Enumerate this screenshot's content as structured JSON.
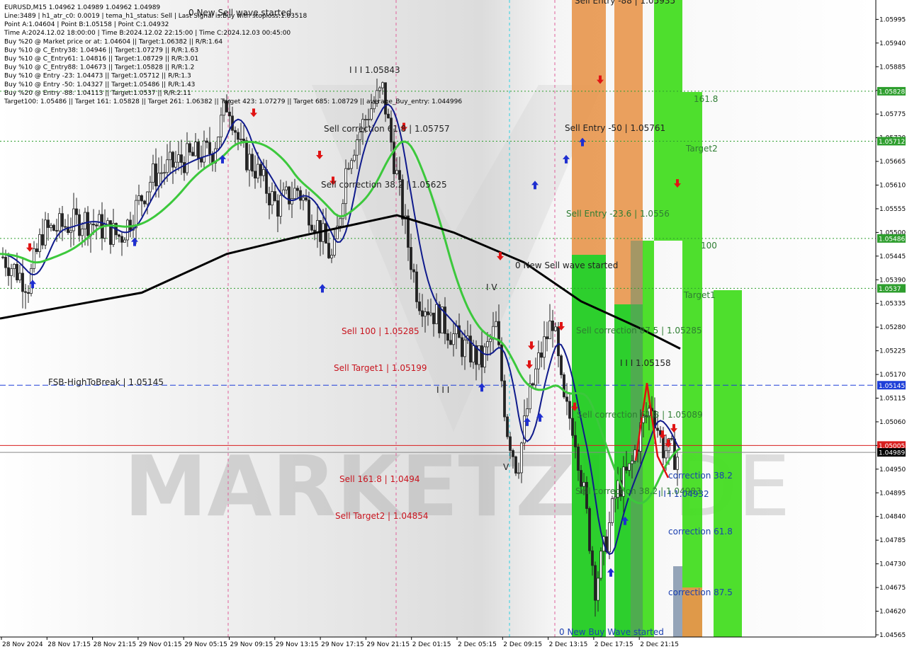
{
  "header": {
    "symbol_line": "EURUSD,M15   1.04962 1.04989 1.04962 1.04989",
    "info_lines": [
      "Line:3489 | h1_atr_c0: 0.0019 | tema_h1_status: Sell | Last Signal is:Buy with stoploss:1.03518",
      "Point A:1.04604 | Point B:1.05158 | Point C:1.04932",
      "Time A:2024.12.02 18:00:00 | Time B:2024.12.02 22:15:00 | Time C:2024.12.03 00:45:00",
      "Buy %20 @ Market price or at: 1.04604 || Target:1.06382 || R/R:1.64",
      "Buy %10 @ C_Entry38: 1.04946 || Target:1.07279 || R/R:1.63",
      "Buy %10 @ C_Entry61: 1.04816 || Target:1.08729 || R/R:3.01",
      "Buy %10 @ C_Entry88: 1.04673 || Target:1.05828 || R/R:1.2",
      "Buy %10 @ Entry -23: 1.04473 || Target:1.05712 || R/R:1.3",
      "Buy %10 @ Entry -50: 1.04327 || Target:1.05486 || R/R:1.43",
      "Buy %20 @ Entry -88: 1.04113 || Target:1.0537 || R/R:2.11",
      "Target100: 1.05486 || Target 161: 1.05828 || Target 261: 1.06382 || Target 423: 1.07279 || Target 685: 1.08729 || average_Buy_entry: 1.044996"
    ]
  },
  "watermark": "MARKETZI",
  "watermark_tail": "DE",
  "chart_data": {
    "type": "candlestick",
    "symbol": "EURUSD",
    "timeframe": "M15",
    "ylim": [
      1.0456,
      1.0604
    ],
    "price_ticks": [
      "1.05995",
      "1.05940",
      "1.05885",
      "1.05830",
      "1.05775",
      "1.05720",
      "1.05665",
      "1.05610",
      "1.05555",
      "1.05500",
      "1.05445",
      "1.05390",
      "1.05335",
      "1.05280",
      "1.05225",
      "1.05170",
      "1.05115",
      "1.05060",
      "1.05005",
      "1.04950",
      "1.04895",
      "1.04840",
      "1.04785",
      "1.04730",
      "1.04675",
      "1.04620",
      "1.04565"
    ],
    "time_ticks": [
      "28 Nov 2024",
      "28 Nov 17:15",
      "28 Nov 21:15",
      "29 Nov 01:15",
      "29 Nov 05:15",
      "29 Nov 09:15",
      "29 Nov 13:15",
      "29 Nov 17:15",
      "29 Nov 21:15",
      "2 Dec 01:15",
      "2 Dec 05:15",
      "2 Dec 09:15",
      "2 Dec 13:15",
      "2 Dec 17:15",
      "2 Dec 21:15"
    ],
    "price_badges": [
      {
        "price": 1.05828,
        "label": "1.05828",
        "color": "#2e9e2e"
      },
      {
        "price": 1.05712,
        "label": "1.05712",
        "color": "#2e9e2e"
      },
      {
        "price": 1.05486,
        "label": "1.05486",
        "color": "#2e9e2e"
      },
      {
        "price": 1.0537,
        "label": "1.0537",
        "color": "#2e9e2e"
      },
      {
        "price": 1.05145,
        "label": "1.05145",
        "color": "#1e3fd8"
      },
      {
        "price": 1.05005,
        "label": "1.05005",
        "color": "#d81e1e"
      },
      {
        "price": 1.04989,
        "label": "1.04989",
        "color": "#000000"
      }
    ],
    "horizontal_lines": [
      {
        "price": 1.05828,
        "style": "dotted",
        "color": "#2e9e2e"
      },
      {
        "price": 1.05712,
        "style": "dotted",
        "color": "#2e9e2e"
      },
      {
        "price": 1.05486,
        "style": "dotted",
        "color": "#2e9e2e"
      },
      {
        "price": 1.0537,
        "style": "dotted",
        "color": "#2e9e2e"
      },
      {
        "price": 1.05145,
        "style": "dashed",
        "color": "#1e3fd8"
      },
      {
        "price": 1.05005,
        "style": "solid",
        "color": "#d81e1e"
      },
      {
        "price": 1.04989,
        "style": "solid",
        "color": "#888888"
      }
    ],
    "level_labels": [
      {
        "text": "I I I 1.05843",
        "color": "dark"
      },
      {
        "text": "Sell correction 61.8 | 1.05757",
        "color": "dark"
      },
      {
        "text": "Sell correction 38.2 | 1.05625",
        "color": "dark"
      },
      {
        "text": "Sell 100 | 1.05285",
        "color": "red"
      },
      {
        "text": "Sell Target1 | 1.05199",
        "color": "red"
      },
      {
        "text": "FSB-HighToBreak | 1.05145",
        "color": "dark"
      },
      {
        "text": "Sell 161.8 | 1.0494",
        "color": "red"
      },
      {
        "text": "Sell Target2 | 1.04854",
        "color": "red"
      },
      {
        "text": "0 New Sell wave started",
        "color": "dark"
      },
      {
        "text": "0 New Sell wave started",
        "color": "dark"
      },
      {
        "text": "Sell Entry -88 | 1.05935",
        "color": "dark"
      },
      {
        "text": "Sell Entry -50 | 1.05761",
        "color": "dark"
      },
      {
        "text": "Sell Entry -23.6 | 1.0556",
        "color": "green"
      },
      {
        "text": "Sell correction 87.5 | 1.05285",
        "color": "green"
      },
      {
        "text": "I I I 1.05158",
        "color": "dark"
      },
      {
        "text": "Sell correction 61.8 | 1.05089",
        "color": "green"
      },
      {
        "text": "Sell correction 38.2 | 1.04983",
        "color": "green"
      },
      {
        "text": "I I I 1.04932",
        "color": "blue"
      },
      {
        "text": "161.8",
        "color": "green"
      },
      {
        "text": "Target2",
        "color": "green"
      },
      {
        "text": "100",
        "color": "green"
      },
      {
        "text": "Target1",
        "color": "green"
      },
      {
        "text": "correction 38.2",
        "color": "blue"
      },
      {
        "text": "correction 61.8",
        "color": "blue"
      },
      {
        "text": "correction 87.5",
        "color": "blue"
      },
      {
        "text": "0 New Buy Wave started",
        "color": "blue"
      },
      {
        "text": "I I I",
        "color": "dark"
      },
      {
        "text": "I V",
        "color": "dark"
      },
      {
        "text": "V",
        "color": "dark"
      }
    ],
    "series": [
      {
        "name": "EMA fast",
        "color": "#0f1a8c"
      },
      {
        "name": "EMA mid",
        "color": "#3cc83c"
      },
      {
        "name": "EMA slow",
        "color": "#000000"
      }
    ],
    "colors": {
      "sell_zone_orange": "#e8964c",
      "sell_zone_green": "#22cc22",
      "buy_zone_green": "#44dd22",
      "bull_candle": "#222222",
      "bear_candle": "#222222"
    }
  }
}
